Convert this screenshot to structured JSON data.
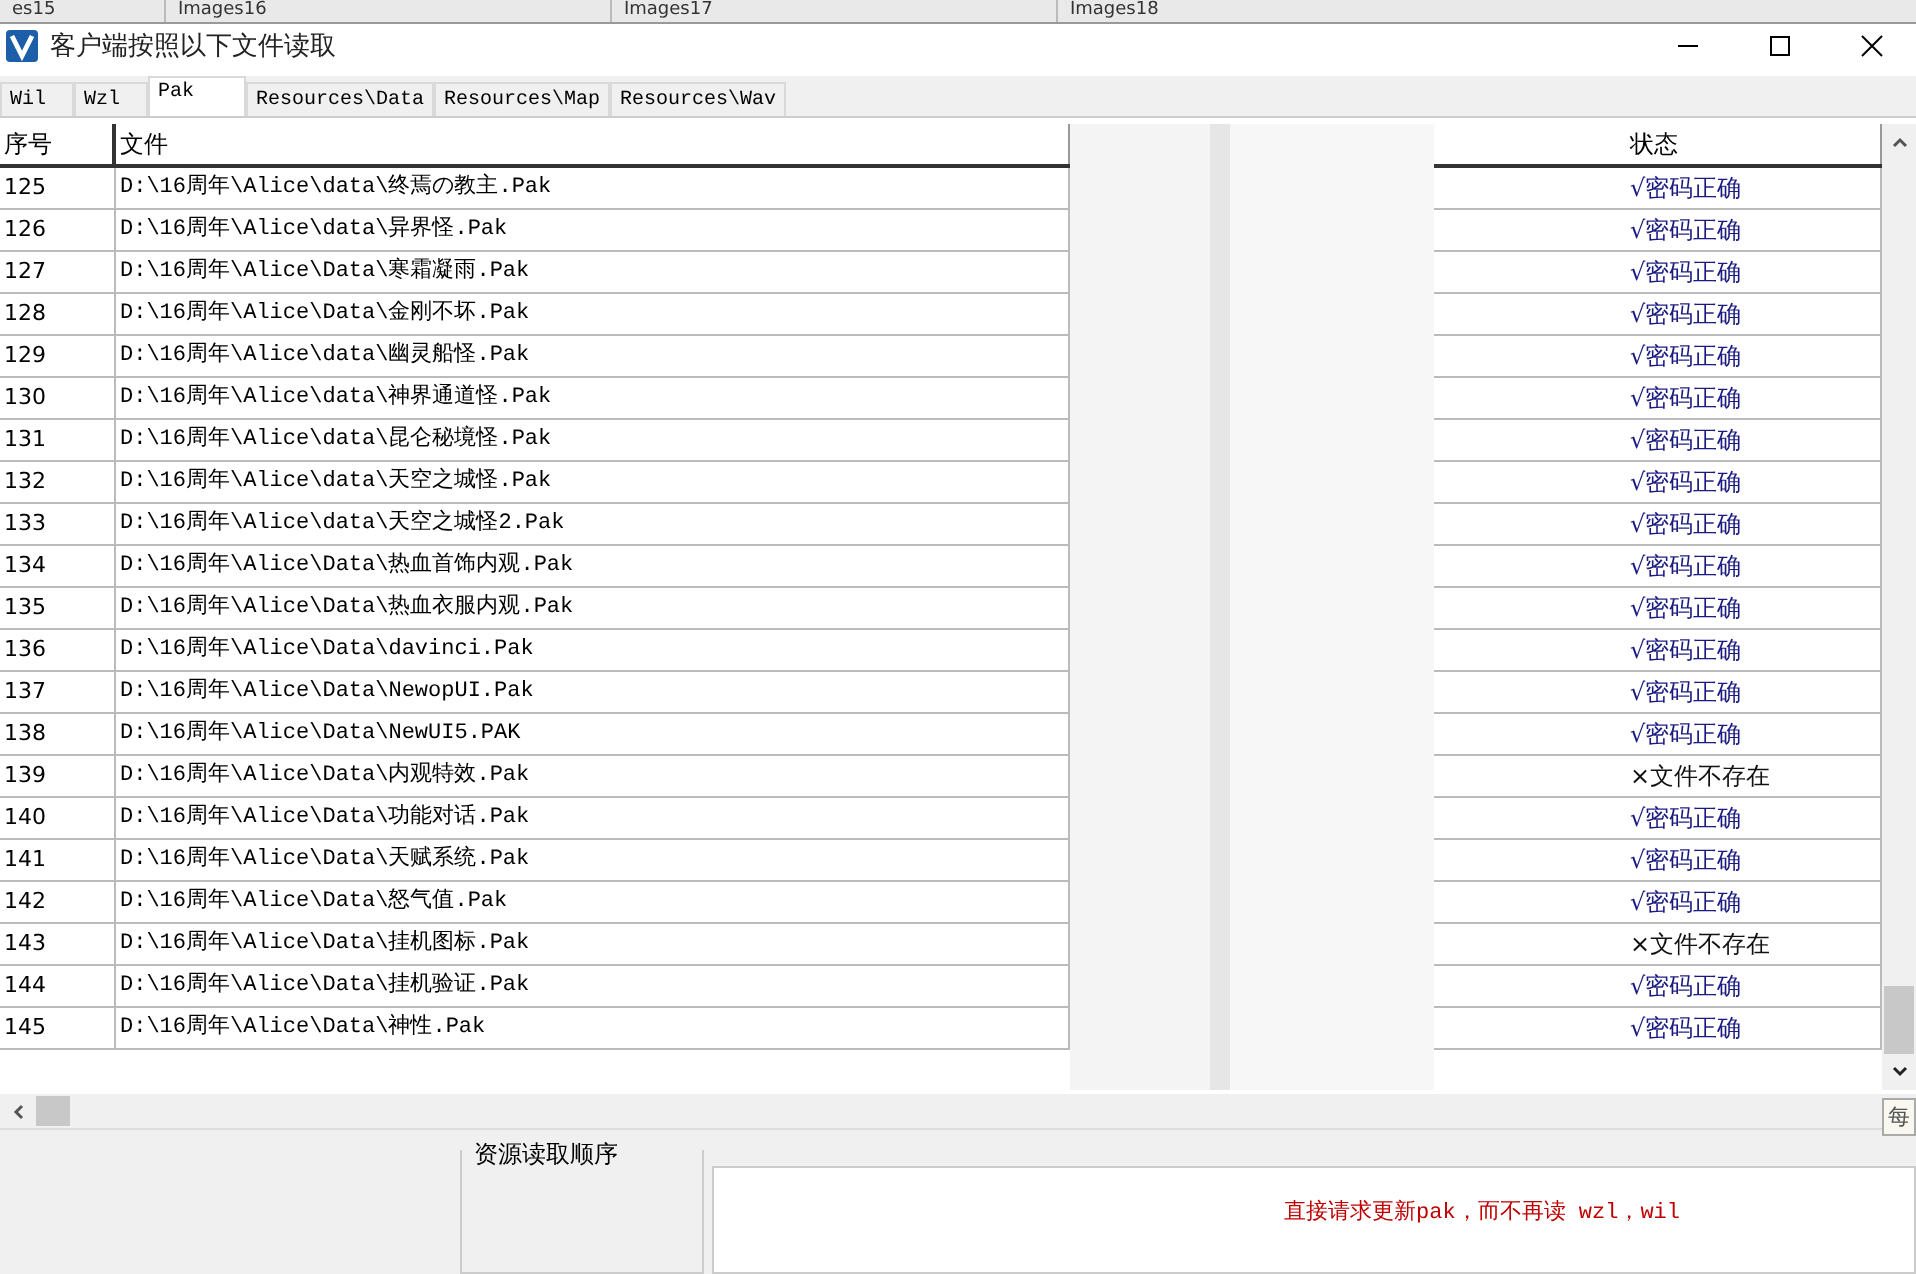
{
  "background_tabs": [
    "es15",
    "Images16",
    "Images17",
    "Images18"
  ],
  "window": {
    "title": "客户端按照以下文件读取"
  },
  "tabs": [
    {
      "label": "Wil",
      "selected": false
    },
    {
      "label": "Wzl",
      "selected": false
    },
    {
      "label": "Pak",
      "selected": true
    },
    {
      "label": "Resources\\Data",
      "selected": false
    },
    {
      "label": "Resources\\Map",
      "selected": false
    },
    {
      "label": "Resources\\Wav",
      "selected": false
    }
  ],
  "table": {
    "columns": [
      "序号",
      "文件",
      "状态"
    ],
    "rows": [
      {
        "index": "125",
        "file": "D:\\16周年\\Alice\\data\\终焉の教主.Pak",
        "status": "√密码正确",
        "kind": "ok"
      },
      {
        "index": "126",
        "file": "D:\\16周年\\Alice\\data\\异界怪.Pak",
        "status": "√密码正确",
        "kind": "ok"
      },
      {
        "index": "127",
        "file": "D:\\16周年\\Alice\\Data\\寒霜凝雨.Pak",
        "status": "√密码正确",
        "kind": "ok"
      },
      {
        "index": "128",
        "file": "D:\\16周年\\Alice\\Data\\金刚不坏.Pak",
        "status": "√密码正确",
        "kind": "ok"
      },
      {
        "index": "129",
        "file": "D:\\16周年\\Alice\\data\\幽灵船怪.Pak",
        "status": "√密码正确",
        "kind": "ok"
      },
      {
        "index": "130",
        "file": "D:\\16周年\\Alice\\data\\神界通道怪.Pak",
        "status": "√密码正确",
        "kind": "ok"
      },
      {
        "index": "131",
        "file": "D:\\16周年\\Alice\\data\\昆仑秘境怪.Pak",
        "status": "√密码正确",
        "kind": "ok"
      },
      {
        "index": "132",
        "file": "D:\\16周年\\Alice\\data\\天空之城怪.Pak",
        "status": "√密码正确",
        "kind": "ok"
      },
      {
        "index": "133",
        "file": "D:\\16周年\\Alice\\data\\天空之城怪2.Pak",
        "status": "√密码正确",
        "kind": "ok"
      },
      {
        "index": "134",
        "file": "D:\\16周年\\Alice\\Data\\热血首饰内观.Pak",
        "status": "√密码正确",
        "kind": "ok"
      },
      {
        "index": "135",
        "file": "D:\\16周年\\Alice\\Data\\热血衣服内观.Pak",
        "status": "√密码正确",
        "kind": "ok"
      },
      {
        "index": "136",
        "file": "D:\\16周年\\Alice\\Data\\davinci.Pak",
        "status": "√密码正确",
        "kind": "ok"
      },
      {
        "index": "137",
        "file": "D:\\16周年\\Alice\\Data\\NewopUI.Pak",
        "status": "√密码正确",
        "kind": "ok"
      },
      {
        "index": "138",
        "file": "D:\\16周年\\Alice\\Data\\NewUI5.PAK",
        "status": "√密码正确",
        "kind": "ok"
      },
      {
        "index": "139",
        "file": "D:\\16周年\\Alice\\Data\\内观特效.Pak",
        "status": "×文件不存在",
        "kind": "missing"
      },
      {
        "index": "140",
        "file": "D:\\16周年\\Alice\\Data\\功能对话.Pak",
        "status": "√密码正确",
        "kind": "ok"
      },
      {
        "index": "141",
        "file": "D:\\16周年\\Alice\\Data\\天赋系统.Pak",
        "status": "√密码正确",
        "kind": "ok"
      },
      {
        "index": "142",
        "file": "D:\\16周年\\Alice\\Data\\怒气值.Pak",
        "status": "√密码正确",
        "kind": "ok"
      },
      {
        "index": "143",
        "file": "D:\\16周年\\Alice\\Data\\挂机图标.Pak",
        "status": "×文件不存在",
        "kind": "missing"
      },
      {
        "index": "144",
        "file": "D:\\16周年\\Alice\\Data\\挂机验证.Pak",
        "status": "√密码正确",
        "kind": "ok"
      },
      {
        "index": "145",
        "file": "D:\\16周年\\Alice\\Data\\神性.Pak",
        "status": "√密码正确",
        "kind": "ok"
      }
    ]
  },
  "bottom": {
    "group_title": "资源读取顺序",
    "note": "直接请求更新pak，而不再读 wzl，wil"
  },
  "tooltip": "每"
}
